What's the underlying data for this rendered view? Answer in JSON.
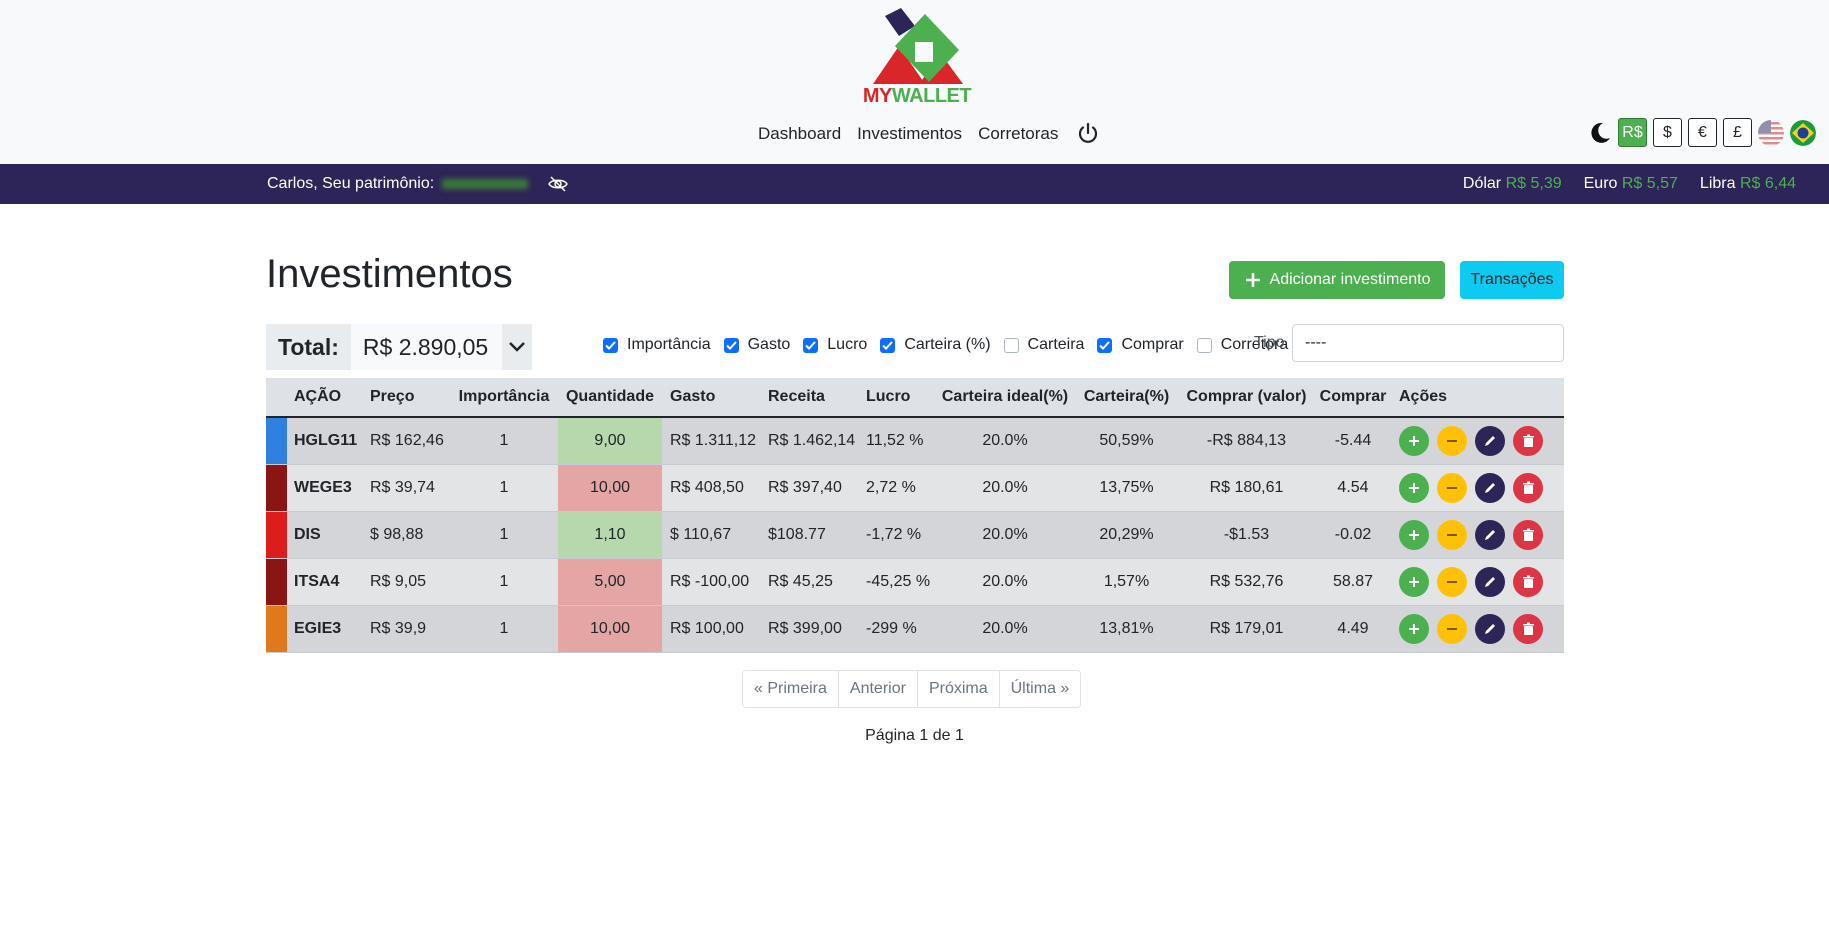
{
  "header": {
    "logo_my": "MY",
    "logo_wallet": "WALLET",
    "nav": [
      "Dashboard",
      "Investimentos",
      "Corretoras"
    ],
    "currencies": [
      {
        "label": "R$",
        "active": true
      },
      {
        "label": "$",
        "active": false
      },
      {
        "label": "€",
        "active": false
      },
      {
        "label": "£",
        "active": false
      }
    ]
  },
  "topbar": {
    "greeting": "Carlos, Seu patrimônio:",
    "rates": [
      {
        "name": "Dólar",
        "value": "R$ 5,39"
      },
      {
        "name": "Euro",
        "value": "R$ 5,57"
      },
      {
        "name": "Libra",
        "value": "R$ 6,44"
      }
    ]
  },
  "main": {
    "title": "Investimentos",
    "add_button": "Adicionar investimento",
    "transactions_button": "Transações",
    "total_label": "Total:",
    "total_value": "R$ 2.890,05",
    "filters": [
      {
        "label": "Importância",
        "checked": true
      },
      {
        "label": "Gasto",
        "checked": true
      },
      {
        "label": "Lucro",
        "checked": true
      },
      {
        "label": "Carteira (%)",
        "checked": true
      },
      {
        "label": "Carteira",
        "checked": false
      },
      {
        "label": "Comprar",
        "checked": true
      },
      {
        "label": "Corretora",
        "checked": false
      }
    ],
    "tipo_label": "Tipo",
    "tipo_value": "----"
  },
  "table": {
    "headers": [
      "AÇÃO",
      "Preço",
      "Importância",
      "Quantidade",
      "Gasto",
      "Receita",
      "Lucro",
      "Carteira ideal(%)",
      "Carteira(%)",
      "Comprar (valor)",
      "Comprar",
      "Ações"
    ],
    "rows": [
      {
        "color": "#2f80e0",
        "acao": "HGLG11",
        "preco": "R$ 162,46",
        "imp": "1",
        "qtd": "9,00",
        "qtd_status": "up",
        "gasto": "R$ 1.311,12",
        "receita": "R$ 1.462,14",
        "lucro": "11,52 %",
        "ideal": "20.0%",
        "carteira": "50,59%",
        "comprar_valor": "-R$ 884,13",
        "comprar": "-5.44"
      },
      {
        "color": "#8b1414",
        "acao": "WEGE3",
        "preco": "R$ 39,74",
        "imp": "1",
        "qtd": "10,00",
        "qtd_status": "down",
        "gasto": "R$ 408,50",
        "receita": "R$ 397,40",
        "lucro": "2,72 %",
        "ideal": "20.0%",
        "carteira": "13,75%",
        "comprar_valor": "R$ 180,61",
        "comprar": "4.54"
      },
      {
        "color": "#dd1c1c",
        "acao": "DIS",
        "preco": "$ 98,88",
        "imp": "1",
        "qtd": "1,10",
        "qtd_status": "up",
        "gasto": "$ 110,67",
        "receita": "$108.77",
        "lucro": "-1,72 %",
        "ideal": "20.0%",
        "carteira": "20,29%",
        "comprar_valor": "-$1.53",
        "comprar": "-0.02"
      },
      {
        "color": "#8b1414",
        "acao": "ITSA4",
        "preco": "R$ 9,05",
        "imp": "1",
        "qtd": "5,00",
        "qtd_status": "down",
        "gasto": "R$ -100,00",
        "receita": "R$ 45,25",
        "lucro": "-45,25 %",
        "ideal": "20.0%",
        "carteira": "1,57%",
        "comprar_valor": "R$ 532,76",
        "comprar": "58.87"
      },
      {
        "color": "#e0781c",
        "acao": "EGIE3",
        "preco": "R$ 39,9",
        "imp": "1",
        "qtd": "10,00",
        "qtd_status": "down",
        "gasto": "R$ 100,00",
        "receita": "R$ 399,00",
        "lucro": "-299 %",
        "ideal": "20.0%",
        "carteira": "13,81%",
        "comprar_valor": "R$ 179,01",
        "comprar": "4.49"
      }
    ]
  },
  "pagination": {
    "buttons": [
      "« Primeira",
      "Anterior",
      "Próxima",
      "Última »"
    ],
    "info": "Página 1 de 1"
  }
}
